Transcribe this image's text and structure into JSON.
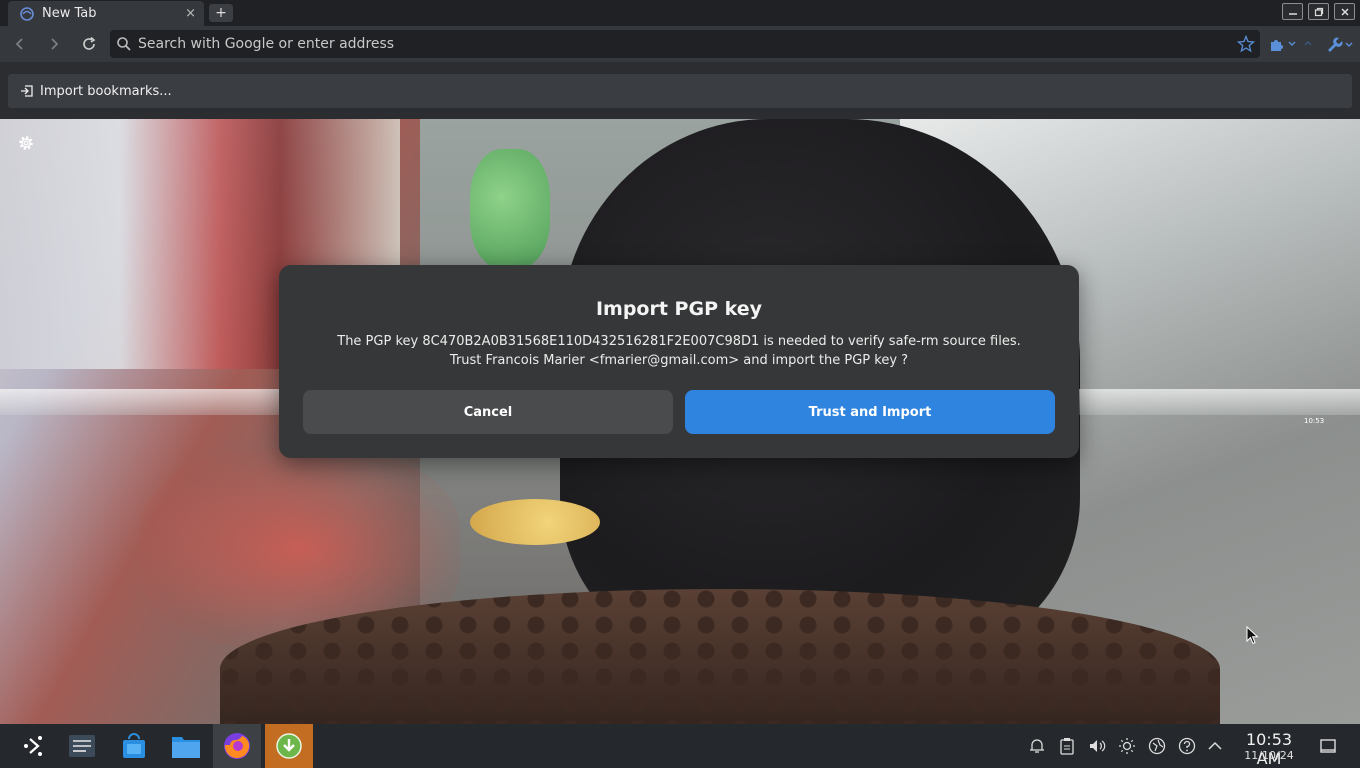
{
  "browser": {
    "tab_title": "New Tab",
    "tab_close": "×",
    "new_tab": "+",
    "url_placeholder": "Search with Google or enter address",
    "bookmarks_button": "Import bookmarks..."
  },
  "dialog": {
    "title": "Import PGP key",
    "message_line1": "The PGP key 8C470B2A0B31568E110D432516281F2E007C98D1 is needed to verify safe-rm source files.",
    "message_line2": "Trust Francois Marier <fmarier@gmail.com> and import the PGP key ?",
    "cancel_label": "Cancel",
    "confirm_label": "Trust and Import"
  },
  "desktop_widget": {
    "time": "10:53"
  },
  "taskbar": {
    "clock_time": "10:53 AM",
    "clock_date": "11/10/24"
  },
  "colors": {
    "accent": "#2f84e0",
    "dialog_bg": "#363738",
    "download_task": "#c26d22"
  },
  "icons": {
    "tab": "firefox-favicon",
    "nav": [
      "back-arrow-icon",
      "forward-arrow-icon",
      "reload-icon"
    ],
    "urlbar": [
      "search-icon",
      "bookmark-star-icon"
    ],
    "toolbar_right": [
      "extension-icon",
      "wrench-icon"
    ],
    "taskbar": [
      "app-launcher-icon",
      "system-settings-icon",
      "discover-store-icon",
      "file-manager-icon",
      "firefox-icon",
      "download-manager-icon"
    ],
    "tray": [
      "notifications-icon",
      "clipboard-icon",
      "volume-icon",
      "brightness-icon",
      "network-icon",
      "help-icon",
      "tray-expand-icon",
      "show-desktop-icon"
    ]
  }
}
